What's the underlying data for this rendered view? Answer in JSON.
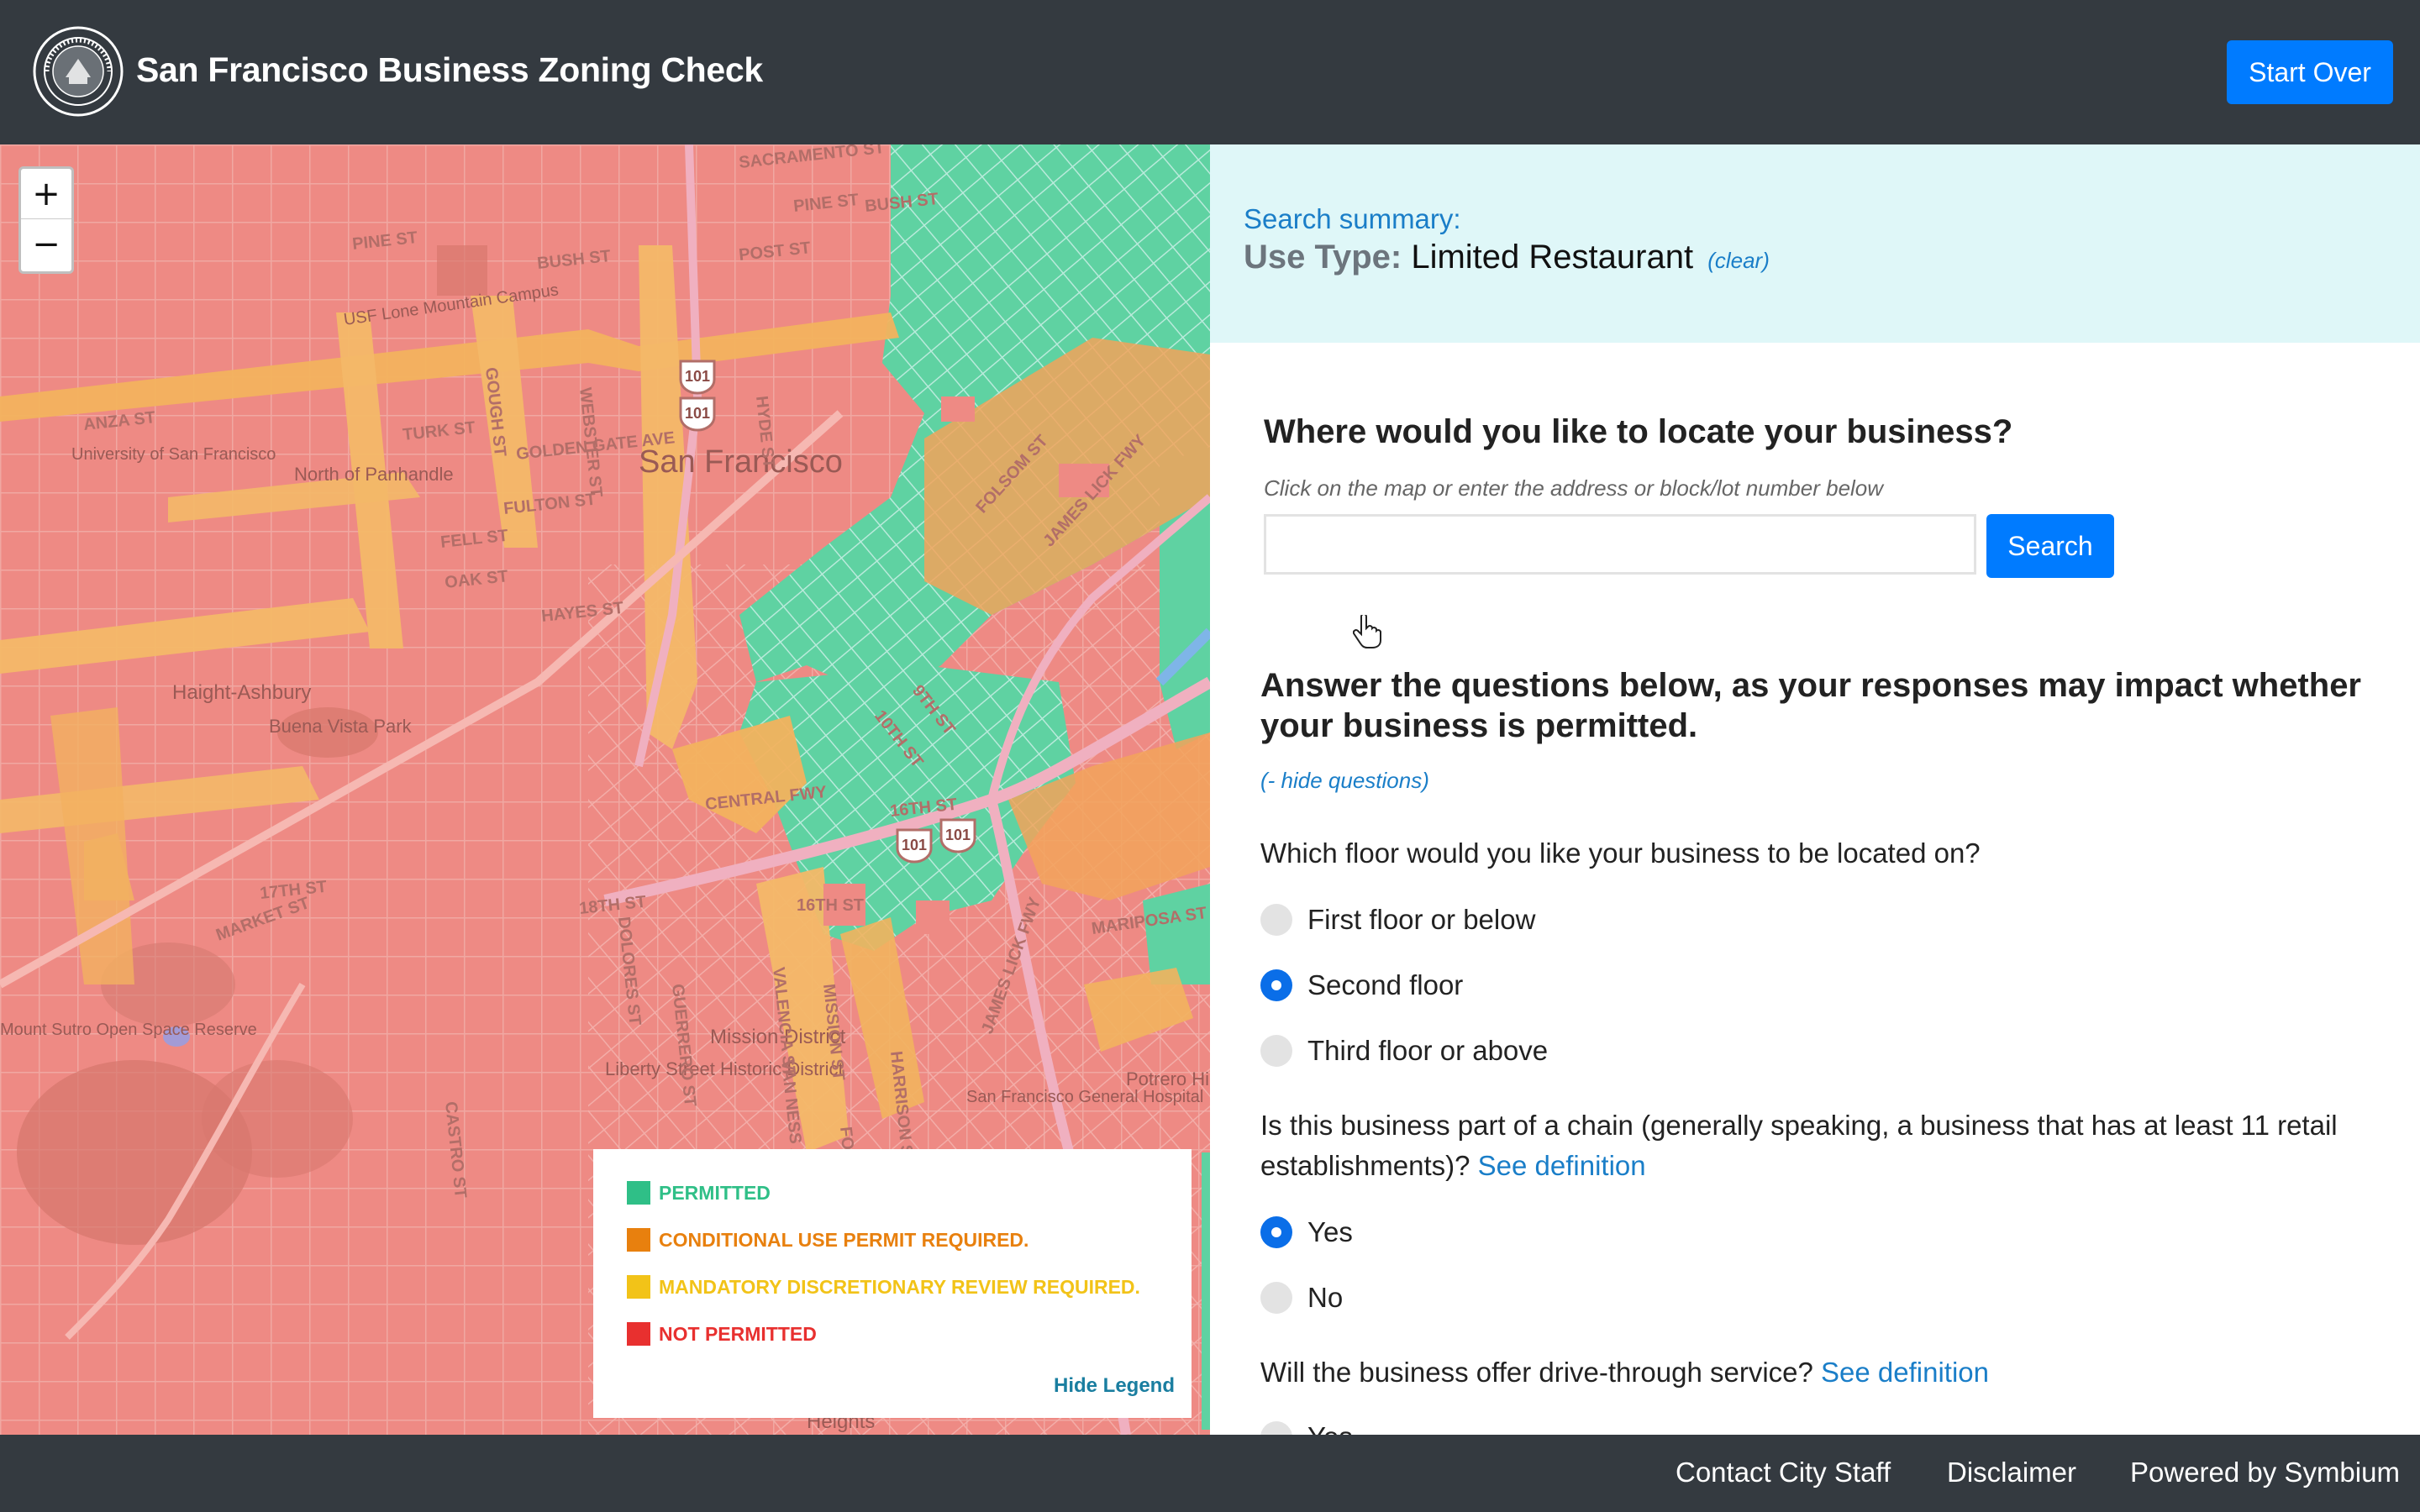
{
  "header": {
    "title": "San Francisco Business Zoning Check",
    "start_over_label": "Start Over"
  },
  "map": {
    "zoom_in_label": "+",
    "zoom_out_label": "−",
    "place_labels": [
      "San Francisco",
      "SACRAMENTO ST",
      "PINE ST",
      "BUSH ST",
      "POST ST",
      "TURK ST",
      "GOLDEN GATE AVE",
      "FULTON ST",
      "FELL ST",
      "OAK ST",
      "HAYES ST",
      "FOLSOM ST",
      "JAMES LICK FWY",
      "CENTRAL FWY",
      "10TH ST",
      "9TH ST",
      "16TH ST",
      "17TH ST",
      "18TH ST",
      "MARKET ST",
      "MARIPOSA ST",
      "DOLORES ST",
      "GUERRERO ST",
      "VALENCIA ST",
      "MISSION ST",
      "FOLSOM ST",
      "HARRISON ST",
      "CASTRO ST",
      "VAN NESS AVE",
      "GOUGH ST",
      "WEBSTER ST",
      "HYDE ST",
      "ANZA ST",
      "USF Lone Mountain Campus",
      "University of San Francisco",
      "North of Panhandle",
      "Haight-Ashbury",
      "Buena Vista Park",
      "Mission District",
      "Liberty Street Historic District",
      "Potrero Hill",
      "San Francisco General Hospital",
      "Mount Sutro Open Space Reserve",
      "Heights"
    ],
    "highway_shields": [
      "101",
      "101",
      "101",
      "101"
    ],
    "legend": {
      "items": [
        {
          "label": "PERMITTED",
          "color": "#2fbf87"
        },
        {
          "label": "CONDITIONAL USE PERMIT REQUIRED.",
          "color": "#e8800e"
        },
        {
          "label": "MANDATORY DISCRETIONARY REVIEW REQUIRED.",
          "color": "#f2c318"
        },
        {
          "label": "NOT PERMITTED",
          "color": "#e8302f"
        }
      ],
      "hide_label": "Hide Legend"
    }
  },
  "summary": {
    "label": "Search summary:",
    "use_type_label": "Use Type:",
    "use_type_value": "Limited Restaurant",
    "clear_label": "(clear)"
  },
  "location": {
    "heading": "Where would you like to locate your business?",
    "hint": "Click on the map or enter the address or block/lot number below",
    "input_value": "",
    "search_label": "Search"
  },
  "questions": {
    "heading": "Answer the questions below, as your responses may impact whether your business is permitted.",
    "hide_label": "(- hide questions)",
    "floor": {
      "text": "Which floor would you like your business to be located on?",
      "options": [
        {
          "label": "First floor or below",
          "selected": false
        },
        {
          "label": "Second floor",
          "selected": true
        },
        {
          "label": "Third floor or above",
          "selected": false
        }
      ]
    },
    "chain": {
      "text": "Is this business part of a chain (generally speaking, a business that has at least 11 retail establishments)?",
      "definition_label": "See definition",
      "options": [
        {
          "label": "Yes",
          "selected": true
        },
        {
          "label": "No",
          "selected": false
        }
      ]
    },
    "drive_through": {
      "text": "Will the business offer drive-through service?",
      "definition_label": "See definition",
      "options": [
        {
          "label": "Yes",
          "selected": false
        }
      ]
    }
  },
  "footer": {
    "contact_label": "Contact City Staff",
    "disclaimer_label": "Disclaimer",
    "powered_label": "Powered by Symbium"
  },
  "colors": {
    "header_bg": "#343a40",
    "primary": "#007bff",
    "summary_bg": "#dff7f8",
    "link": "#1a7ec8"
  }
}
